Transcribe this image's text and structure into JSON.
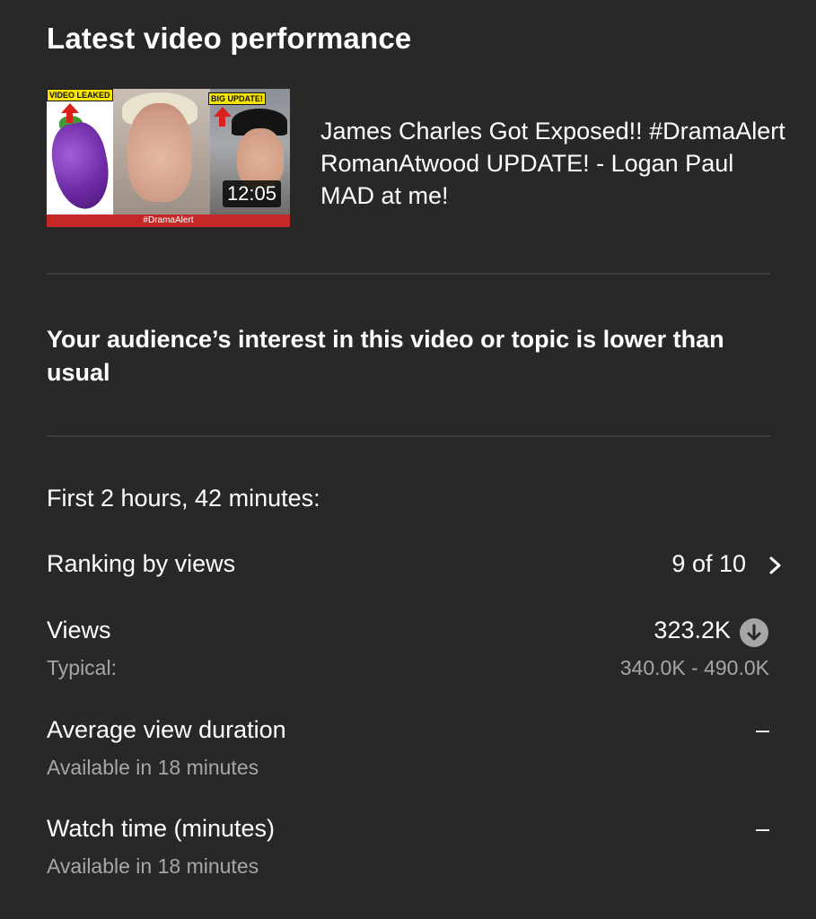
{
  "section_title": "Latest video performance",
  "video": {
    "thumbnail": {
      "tag_left": "VIDEO LEAKED",
      "tag_right": "BIG UPDATE!",
      "caption": "#DramaAlert",
      "duration": "12:05"
    },
    "title": "James Charles Got Exposed!! #DramaAlert RomanAtwood UPDATE! - Logan Paul MAD at me!"
  },
  "insight": "Your audience’s interest in this video or topic is lower than usual",
  "period": "First 2 hours, 42 minutes:",
  "metrics": {
    "ranking": {
      "label": "Ranking by views",
      "value": "9 of 10",
      "icon": "chevron-right-icon"
    },
    "views": {
      "label": "Views",
      "value": "323.2K",
      "icon": "arrow-down-circle-icon",
      "typical_label": "Typical:",
      "typical_value": "340.0K - 490.0K"
    },
    "avg_view_duration": {
      "label": "Average view duration",
      "value": "–",
      "sub": "Available in 18 minutes"
    },
    "watch_time": {
      "label": "Watch time (minutes)",
      "value": "–",
      "sub": "Available in 18 minutes"
    }
  },
  "colors": {
    "background": "#282828",
    "text_primary": "#ffffff",
    "text_secondary": "#a6a6a6",
    "divider": "#3d3d3d",
    "thumbnail_banner": "#c62828",
    "tag_yellow": "#f7e300"
  }
}
